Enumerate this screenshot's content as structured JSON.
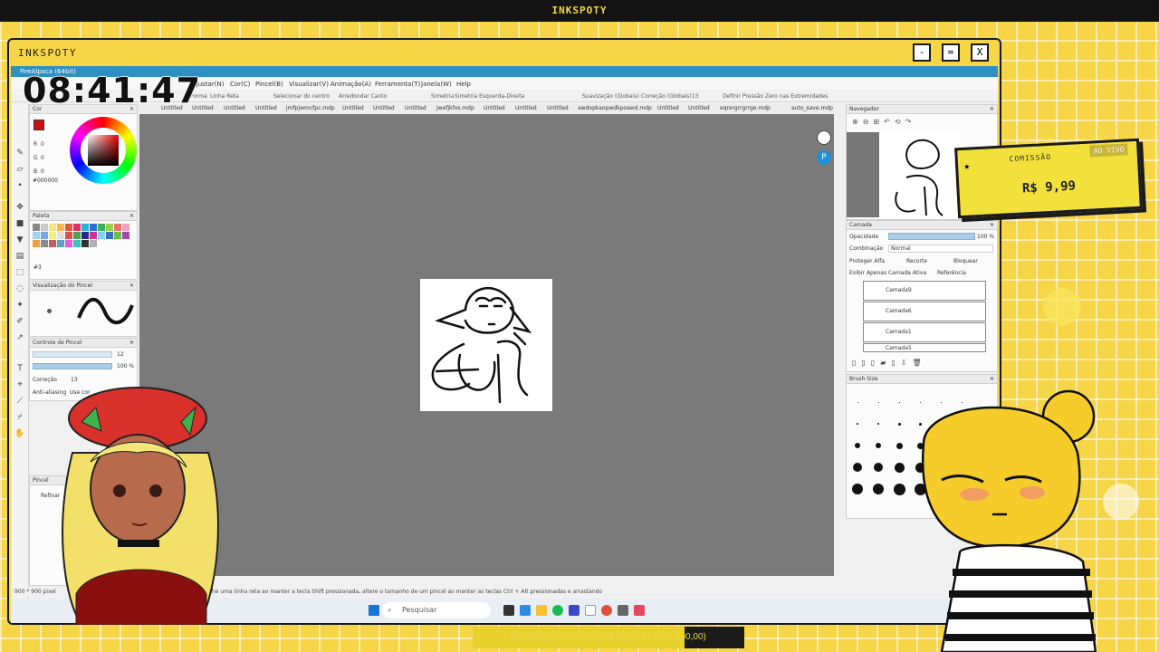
{
  "stream": {
    "top_title": "INKSPOTY",
    "window_title": "INKSPOTY",
    "window_buttons": [
      "-",
      "=",
      "X"
    ],
    "clock": "08:41:47"
  },
  "app": {
    "title": "FireAlpaca (64bit)",
    "menu": [
      "Ajustar(N)",
      "Cor(C)",
      "Pincel(B)",
      "Visualizar(V)",
      "Animação(A)",
      "Ferramenta(T)",
      "Janela(W)",
      "Help"
    ],
    "options": {
      "forma": "Forma",
      "forma_value": "Linha Reta",
      "select_center": "Selecionar do centro",
      "round_corner": "Arredondar Canto",
      "symmetry": "Simetria",
      "symmetry_value": "Simetria Esquerda-Direita",
      "smoothing": "Suavização (Globais)",
      "correction": "Correção (Globais)",
      "correction_value": "13",
      "pressure": "Definir Pressão Zero nas Extremidades"
    },
    "tabs": [
      "Untitled",
      "Untitled",
      "Untitled",
      "Untitled",
      "jmfpjwmcfpc.mdp",
      "Untitled",
      "Untitled",
      "Untitled",
      "jwefjkfos.mdp",
      "Untitled",
      "Untitled",
      "Untitled",
      "awdopkaopwdkpoawd.mdp",
      "Untitled",
      "Untitled",
      "eqrergrrgrrge.mdp",
      "auto_save.mdp"
    ],
    "panels": {
      "color": {
        "title": "Cor",
        "r": "R",
        "r_val": "0",
        "g": "G",
        "g_val": "0",
        "b": "B",
        "b_val": "0",
        "hex": "#000000"
      },
      "palette": {
        "title": "Paleta",
        "number": "#3"
      },
      "brush_preview": {
        "title": "Visualização do Pincel"
      },
      "brush_control": {
        "title": "Controle de Pincel",
        "size": "12",
        "opacity": "100 %",
        "correction_label": "Correção",
        "correction_val": "13",
        "antialias": "Anti-aliasing",
        "use_label": "Use cor"
      },
      "brush": {
        "title": "Pincel",
        "refine": "Refinar"
      },
      "navigator": {
        "title": "Navegador"
      },
      "layer": {
        "title": "Camada",
        "opacity_label": "Opacidade",
        "opacity_val": "100 %",
        "blend_label": "Combinação",
        "blend_val": "Normal",
        "protect_alpha": "Proteger Alfa",
        "clip": "Recorte",
        "lock": "Bloquear",
        "show_active": "Exibir Apenas Camada Ativa",
        "reference": "Referência",
        "layers": [
          "Camada9",
          "Camada6",
          "Camada1",
          "Camada5"
        ]
      },
      "brush_size": {
        "title": "Brush Size"
      }
    },
    "status": "900 * 900 pixel",
    "hint": "he uma linha reta ao manter a tecla Shift pressionada, altere o tamanho de um pincel ao manter as teclas Ctrl + Alt pressionadas e arrastando"
  },
  "taskbar": {
    "search": "Pesquisar"
  },
  "commission": {
    "label": "COMISSÃO",
    "live": "AO VIVO",
    "price": "R$ 9,99"
  },
  "fundraiser": {
    "text": "arrecadando dinheiro (R$ 1.771,91/R$ 2.000,00)",
    "progress": 0.886
  }
}
